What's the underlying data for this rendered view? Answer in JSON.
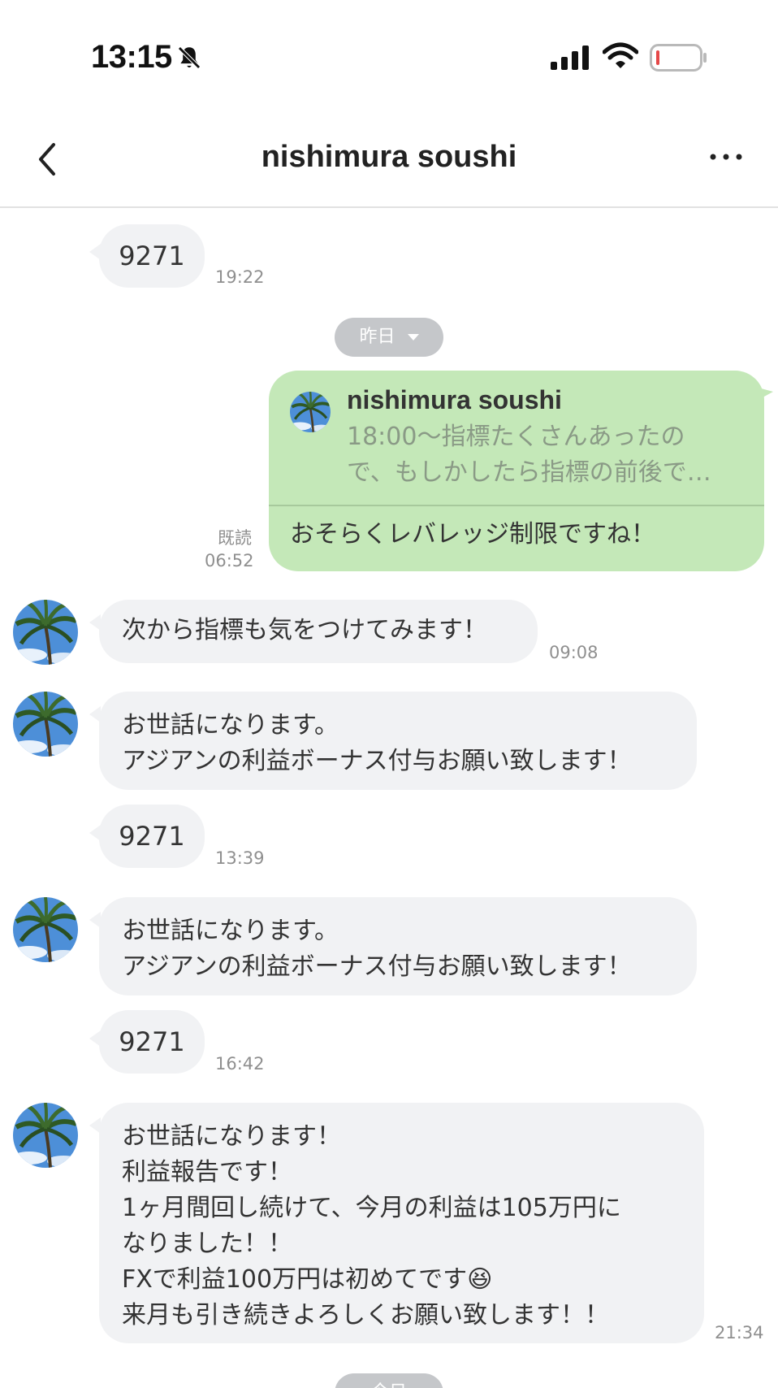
{
  "status_bar": {
    "time": "13:15"
  },
  "header": {
    "title": "nishimura soushi"
  },
  "date_separators": {
    "yesterday": "昨日",
    "today": "今日"
  },
  "messages": [
    {
      "type": "in",
      "text": "9271",
      "time": "19:22"
    },
    {
      "type": "out",
      "reply_sender": "nishimura soushi",
      "reply_text": "18:00〜指標たくさんあったの\nで、もしかしたら指標の前後で…",
      "text": "おそらくレバレッジ制限ですね！",
      "read": "既読",
      "time": "06:52"
    },
    {
      "type": "in",
      "text": "次から指標も気をつけてみます！",
      "time": "09:08"
    },
    {
      "type": "in",
      "text": "お世話になります。\nアジアンの利益ボーナス付与お願い致します！",
      "time": ""
    },
    {
      "type": "in",
      "text": "9271",
      "time": "13:39"
    },
    {
      "type": "in",
      "text": "お世話になります。\nアジアンの利益ボーナス付与お願い致します！",
      "time": ""
    },
    {
      "type": "in",
      "text": "9271",
      "time": "16:42"
    },
    {
      "type": "in",
      "text": "お世話になります！\n利益報告です！\n1ヶ月間回し続けて、今月の利益は105万円に\nなりました！！\nFXで利益100万円は初めてです😆\n来月も引き続きよろしくお願い致します！！",
      "time": "21:34"
    }
  ],
  "icons": {
    "back": "chevron-left-icon",
    "more": "more-dots-icon",
    "mute": "bell-off-icon",
    "signal": "signal-icon",
    "wifi": "wifi-icon",
    "battery": "battery-icon",
    "avatar": "palm-tree-avatar"
  },
  "colors": {
    "outgoing_bubble": "#c4e8b8",
    "incoming_bubble": "#f1f2f4",
    "date_pill": "#c5c7ca",
    "battery_low": "#e54848"
  }
}
